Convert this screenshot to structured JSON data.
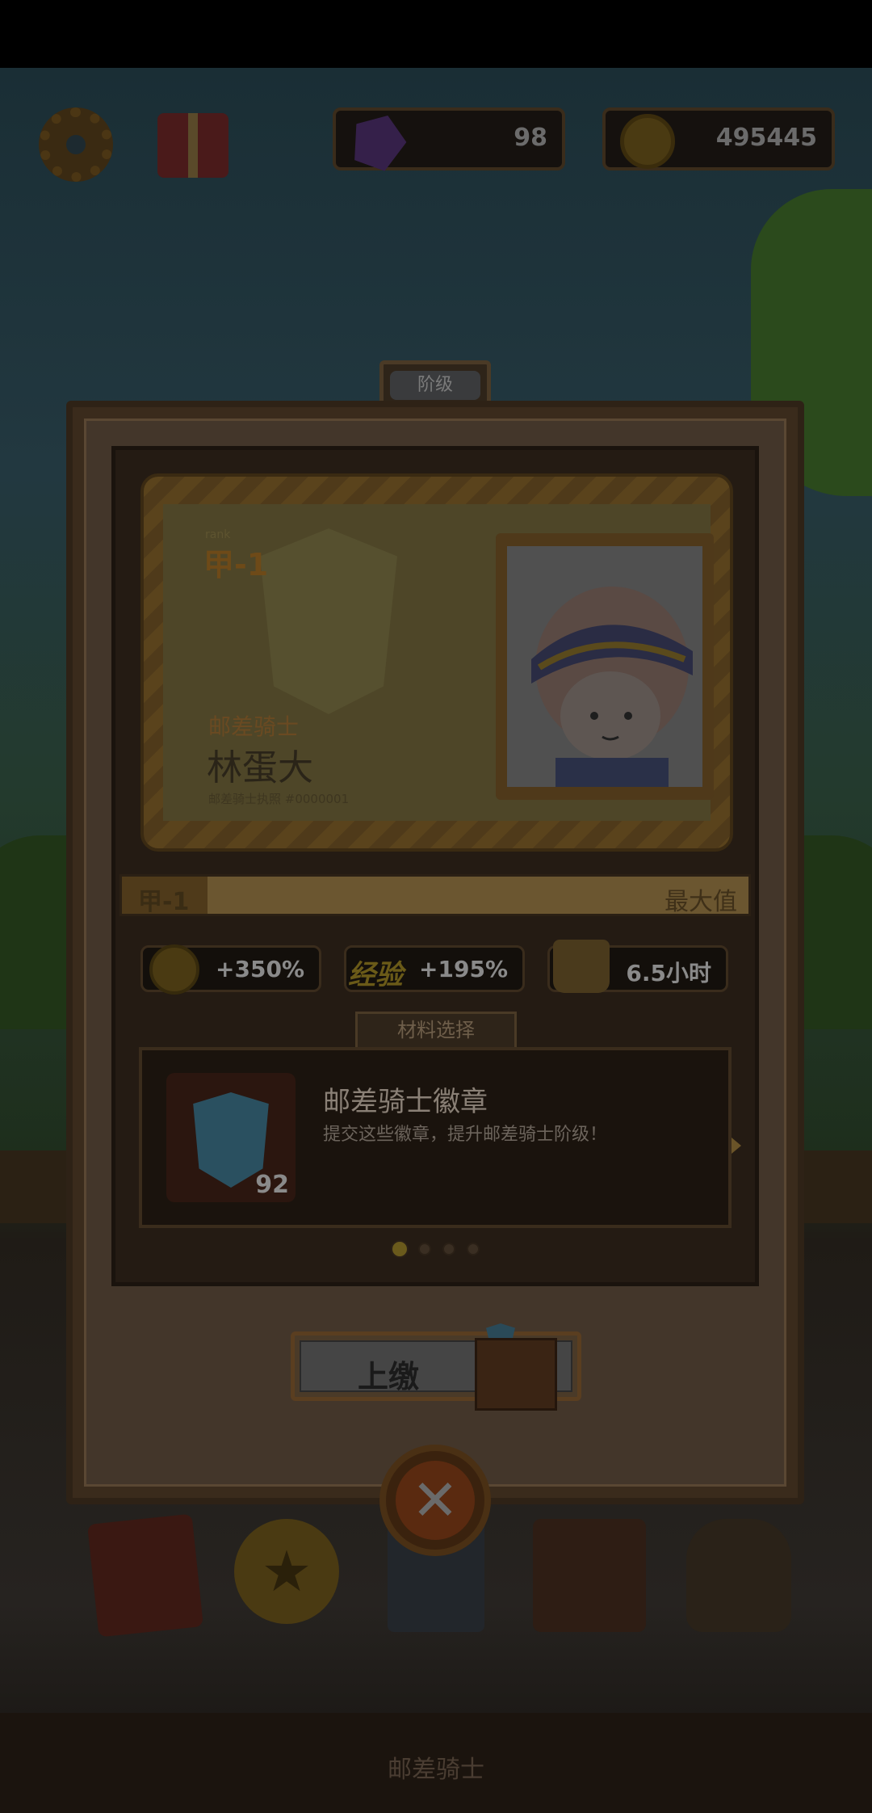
{
  "hud": {
    "gems": "98",
    "coins": "495445"
  },
  "modal": {
    "tab_title": "阶级",
    "card": {
      "rank_small": "rank",
      "rank": "甲-1",
      "role": "邮差骑士",
      "name": "林蛋大",
      "license": "邮差骑士执照 #0000001"
    },
    "level_bar": {
      "rank": "甲-1",
      "max_label": "最大值",
      "progress": 1.0
    },
    "stats": [
      {
        "icon": "coin-icon",
        "value": "+350%"
      },
      {
        "label": "经验",
        "value": "+195%"
      },
      {
        "icon": "basket-icon",
        "value": "6.5小时"
      }
    ],
    "material_tab": "材料选择",
    "material": {
      "title": "邮差骑士徽章",
      "description": "提交这些徽章，提升邮差骑士阶级！",
      "count": "92"
    },
    "pagination": {
      "total": 4,
      "active": 0
    },
    "submit_label": "上缴"
  },
  "bottom_nav": {
    "title": "邮差骑士",
    "items": [
      "book-icon",
      "star-coin-icon",
      "knight-card-icon",
      "bag-icon",
      "money-sack-icon"
    ]
  },
  "colors": {
    "overlay": "#000000",
    "panel": "#3a2b1c",
    "accent_gold": "#6b5630"
  }
}
